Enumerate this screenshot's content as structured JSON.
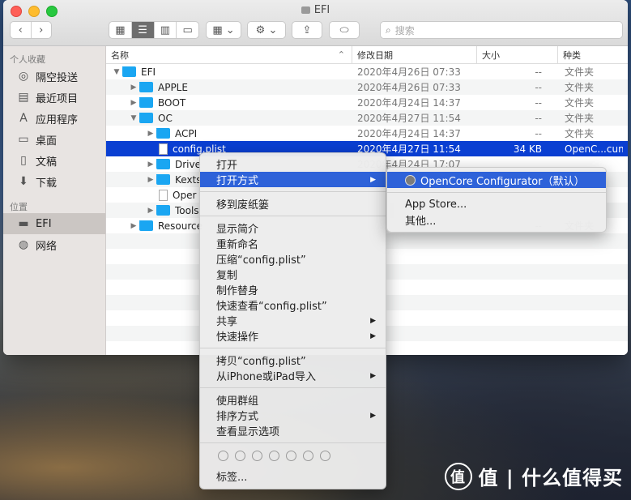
{
  "window": {
    "title": "EFI"
  },
  "search": {
    "placeholder": "搜索"
  },
  "sidebar": {
    "favorites_header": "个人收藏",
    "favorites": [
      {
        "label": "隔空投送",
        "icon": "airdrop-icon"
      },
      {
        "label": "最近项目",
        "icon": "recents-icon"
      },
      {
        "label": "应用程序",
        "icon": "applications-icon"
      },
      {
        "label": "桌面",
        "icon": "desktop-icon"
      },
      {
        "label": "文稿",
        "icon": "documents-icon"
      },
      {
        "label": "下载",
        "icon": "downloads-icon"
      }
    ],
    "locations_header": "位置",
    "locations": [
      {
        "label": "EFI",
        "icon": "drive-icon",
        "selected": true
      },
      {
        "label": "网络",
        "icon": "network-icon"
      }
    ]
  },
  "columns": {
    "name": "名称",
    "date": "修改日期",
    "size": "大小",
    "kind": "种类"
  },
  "rows": [
    {
      "name": "EFI",
      "date": "2020年4月26日 07:33",
      "size": "--",
      "kind": "文件夹",
      "type": "folder",
      "depth": 0,
      "expanded": true
    },
    {
      "name": "APPLE",
      "date": "2020年4月26日 07:33",
      "size": "--",
      "kind": "文件夹",
      "type": "folder",
      "depth": 1,
      "expanded": false
    },
    {
      "name": "BOOT",
      "date": "2020年4月24日 14:37",
      "size": "--",
      "kind": "文件夹",
      "type": "folder",
      "depth": 1,
      "expanded": false
    },
    {
      "name": "OC",
      "date": "2020年4月27日 11:54",
      "size": "--",
      "kind": "文件夹",
      "type": "folder",
      "depth": 1,
      "expanded": true
    },
    {
      "name": "ACPI",
      "date": "2020年4月24日 14:37",
      "size": "--",
      "kind": "文件夹",
      "type": "folder",
      "depth": 2,
      "expanded": false
    },
    {
      "name": "config.plist",
      "date": "2020年4月27日 11:54",
      "size": "34 KB",
      "kind": "OpenC...cument",
      "type": "file",
      "depth": 2,
      "selected": true
    },
    {
      "name": "Drive",
      "date": "2020年4月24日 17:07",
      "size": "",
      "kind": "",
      "type": "folder",
      "depth": 2,
      "expanded": false
    },
    {
      "name": "Kexts",
      "date": "",
      "size": "",
      "kind": "",
      "type": "folder",
      "depth": 2,
      "expanded": false
    },
    {
      "name": "Oper",
      "date": "",
      "size": "",
      "kind": "",
      "type": "file",
      "depth": 2
    },
    {
      "name": "Tools",
      "date": "",
      "size": "",
      "kind": "",
      "type": "folder",
      "depth": 2,
      "expanded": false
    },
    {
      "name": "Resource",
      "date": "",
      "size": "--",
      "kind": "文件夹",
      "type": "folder",
      "depth": 1,
      "expanded": false
    }
  ],
  "context_menu": {
    "open": "打开",
    "open_with": "打开方式",
    "trash": "移到废纸篓",
    "get_info": "显示简介",
    "rename": "重新命名",
    "compress": "压缩“config.plist”",
    "duplicate": "复制",
    "make_alias": "制作替身",
    "quick_look": "快速查看“config.plist”",
    "share": "共享",
    "quick_actions": "快速操作",
    "copy": "拷贝“config.plist”",
    "import_iphone": "从iPhone或iPad导入",
    "use_groups": "使用群组",
    "sort_by": "排序方式",
    "view_options": "查看显示选项",
    "tags": "标签..."
  },
  "submenu": {
    "default_app": "OpenCore Configurator（默认）",
    "app_store": "App Store...",
    "other": "其他..."
  },
  "watermark": {
    "text": "值 | 什么值得买",
    "logo": "值"
  }
}
